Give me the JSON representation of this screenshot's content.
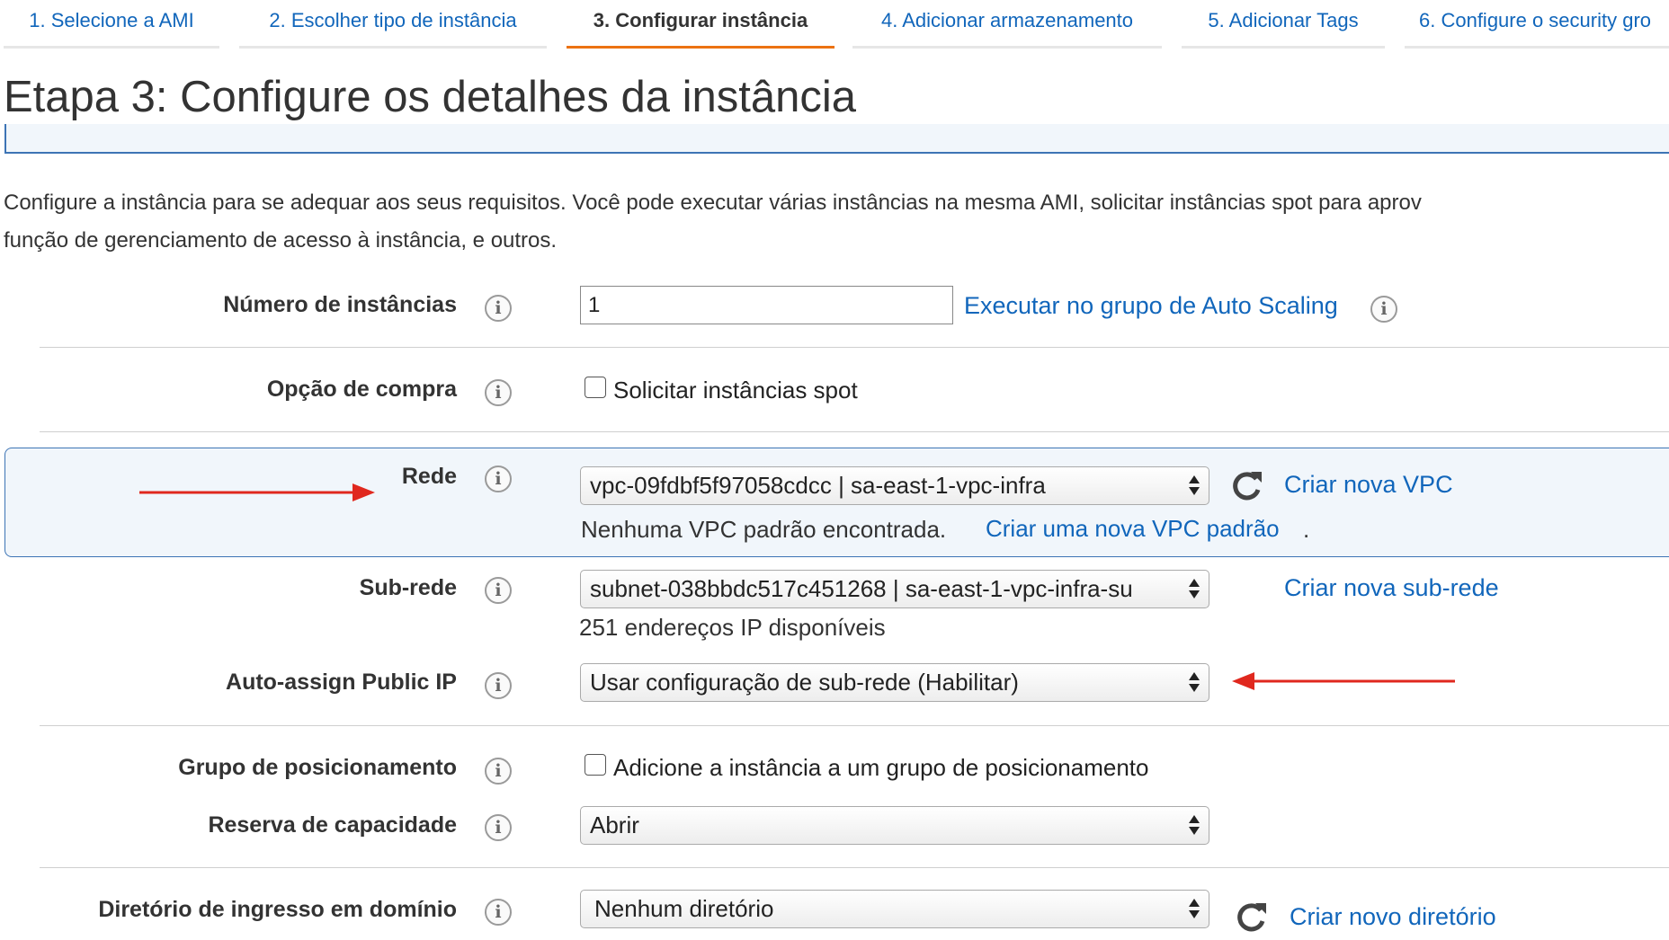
{
  "tabs": [
    {
      "label": "1. Selecione a AMI",
      "active": false
    },
    {
      "label": "2. Escolher tipo de instância",
      "active": false
    },
    {
      "label": "3. Configurar instância",
      "active": true
    },
    {
      "label": "4. Adicionar armazenamento",
      "active": false
    },
    {
      "label": "5. Adicionar Tags",
      "active": false
    },
    {
      "label": "6. Configure o security gro",
      "active": false
    }
  ],
  "page_title": "Etapa 3: Configure os detalhes da instância",
  "description": {
    "line1": "Configure a instância para se adequar aos seus requisitos. Você pode executar várias instâncias na mesma AMI, solicitar instâncias spot para aprov",
    "line2": "função de gerenciamento de acesso à instância, e outros."
  },
  "form": {
    "num_instances": {
      "label": "Número de instâncias",
      "value": "1",
      "link": "Executar no grupo de Auto Scaling"
    },
    "purchase_option": {
      "label": "Opção de compra",
      "checkbox_label": "Solicitar instâncias spot",
      "checked": false
    },
    "network": {
      "label": "Rede",
      "selected": "vpc-09fdbf5f97058cdcc | sa-east-1-vpc-infra",
      "link": "Criar nova VPC",
      "note": "Nenhuma VPC padrão encontrada.",
      "note_link": "Criar uma nova VPC padrão",
      "note_end": "."
    },
    "subnet": {
      "label": "Sub-rede",
      "selected": "subnet-038bbdc517c451268 | sa-east-1-vpc-infra-su",
      "link": "Criar nova sub-rede",
      "note": "251 endereços IP disponíveis"
    },
    "public_ip": {
      "label": "Auto-assign Public IP",
      "selected": "Usar configuração de sub-rede (Habilitar)"
    },
    "placement_group": {
      "label": "Grupo de posicionamento",
      "checkbox_label": "Adicione a instância a um grupo de posicionamento",
      "checked": false
    },
    "capacity_reservation": {
      "label": "Reserva de capacidade",
      "selected": "Abrir"
    },
    "domain_directory": {
      "label": "Diretório de ingresso em domínio",
      "selected": "Nenhum diretório",
      "link": "Criar novo diretório"
    }
  },
  "info_glyph": "i",
  "icons": {
    "info": "info-circle-icon",
    "refresh": "refresh-icon",
    "select_arrows": "updown-arrows-icon",
    "annotation": "red-arrow-icon"
  },
  "colors": {
    "link": "#1166bb",
    "active_tab_underline": "#ec7211",
    "highlight_border": "#3d74b5",
    "highlight_bg": "#f1f6fb",
    "annotation_arrow": "#e0281e"
  }
}
